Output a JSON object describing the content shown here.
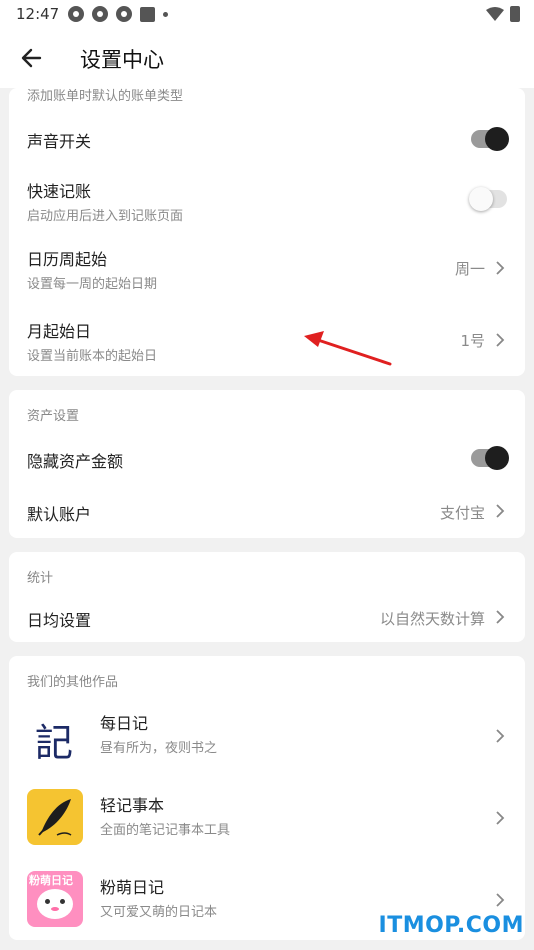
{
  "status_bar": {
    "time": "12:47"
  },
  "app_bar": {
    "title": "设置中心"
  },
  "card1": {
    "partial_text": "添加账单时默认的账单类型",
    "rows": [
      {
        "title": "声音开关",
        "toggle": "on"
      },
      {
        "title": "快速记账",
        "subtitle": "启动应用后进入到记账页面",
        "toggle": "off"
      },
      {
        "title": "日历周起始",
        "subtitle": "设置每一周的起始日期",
        "value": "周一"
      },
      {
        "title": "月起始日",
        "subtitle": "设置当前账本的起始日",
        "value": "1号"
      }
    ]
  },
  "card2": {
    "section": "资产设置",
    "rows": [
      {
        "title": "隐藏资产金额",
        "toggle": "on"
      },
      {
        "title": "默认账户",
        "value": "支付宝"
      }
    ]
  },
  "card3": {
    "section": "统计",
    "rows": [
      {
        "title": "日均设置",
        "value": "以自然天数计算"
      }
    ]
  },
  "card4": {
    "section": "我们的其他作品",
    "apps": [
      {
        "name": "每日记",
        "desc": "昼有所为，夜则书之",
        "icon_text": "記"
      },
      {
        "name": "轻记事本",
        "desc": "全面的笔记记事本工具"
      },
      {
        "name": "粉萌日记",
        "desc": "又可爱又萌的日记本",
        "icon_text": "粉萌日记"
      }
    ]
  },
  "watermark": "ITMOP.COM",
  "colors": {
    "accent_arrow": "#e02020",
    "watermark": "#1a8fe0",
    "toggle_on": "#1e1e1e"
  }
}
